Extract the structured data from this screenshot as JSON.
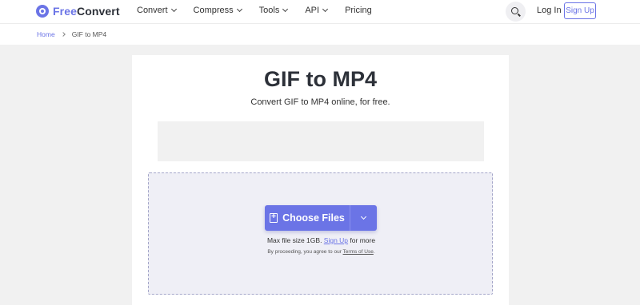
{
  "header": {
    "logo_free": "Free",
    "logo_convert": "Convert",
    "nav": [
      {
        "label": "Convert",
        "has_dropdown": true
      },
      {
        "label": "Compress",
        "has_dropdown": true
      },
      {
        "label": "Tools",
        "has_dropdown": true
      },
      {
        "label": "API",
        "has_dropdown": true
      },
      {
        "label": "Pricing",
        "has_dropdown": false
      }
    ],
    "login_label": "Log In",
    "signup_label": "Sign Up"
  },
  "breadcrumb": {
    "home": "Home",
    "current": "GIF to MP4"
  },
  "main": {
    "title": "GIF to MP4",
    "subtitle": "Convert GIF to MP4 online, for free.",
    "choose_files_label": "Choose Files",
    "max_size_prefix": "Max file size 1GB. ",
    "max_size_link": "Sign Up",
    "max_size_suffix": " for more",
    "terms_prefix": "By proceeding, you agree to our ",
    "terms_link": "Terms of Use",
    "terms_suffix": "."
  },
  "colors": {
    "accent": "#6b74e6",
    "dropzone_bg": "#efeff6",
    "page_bg": "#f1f1f1"
  }
}
